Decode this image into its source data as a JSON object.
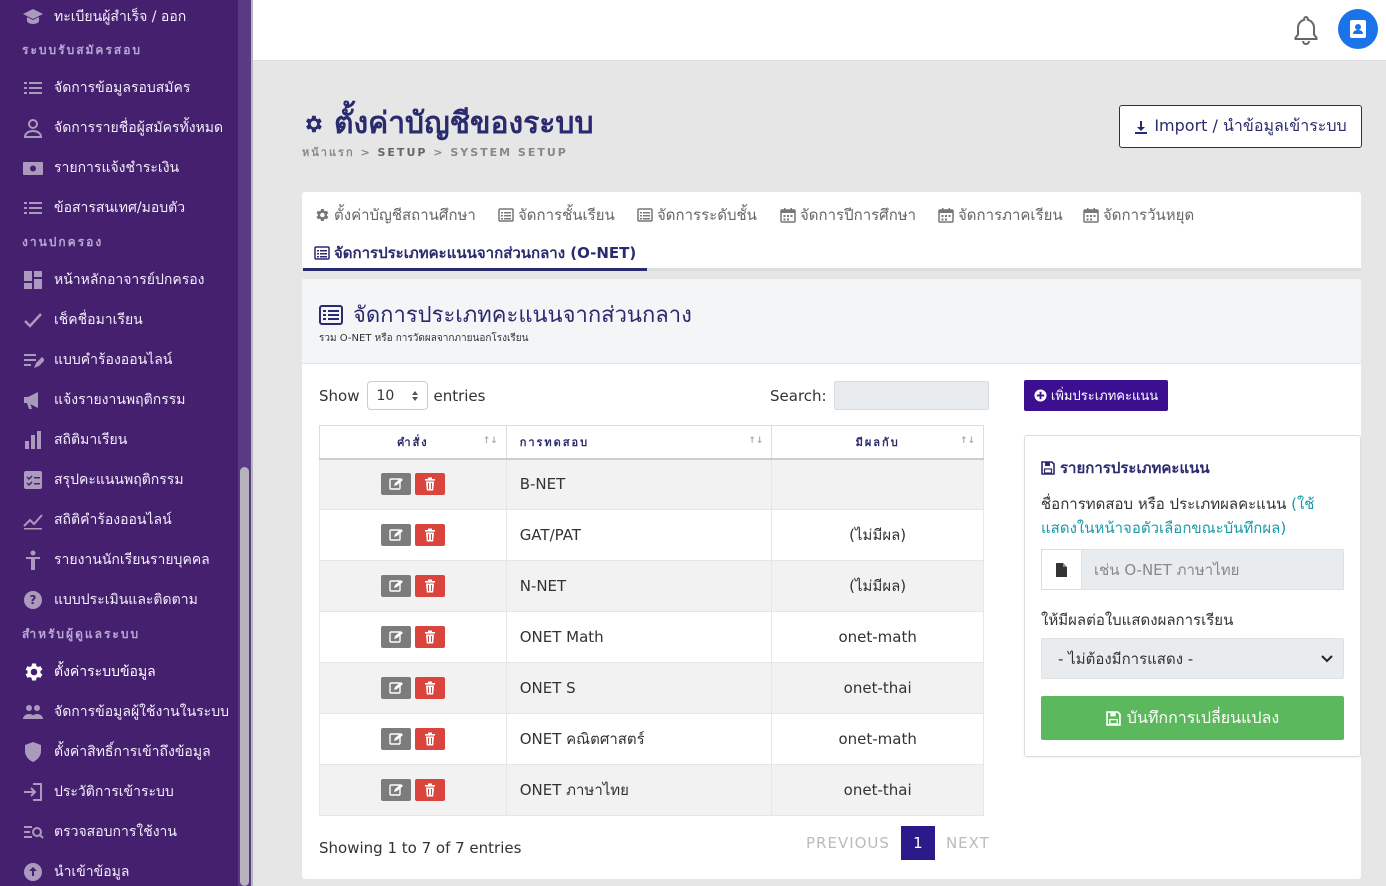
{
  "sidebar": {
    "items_top": [
      {
        "label": "ทะเบียนผู้สำเร็จ / ออก",
        "icon": "graduation-cap-icon"
      }
    ],
    "section1": "ระบบรับสมัครสอบ",
    "items1": [
      {
        "label": "จัดการข้อมูลรอบสมัคร",
        "icon": "list-icon"
      },
      {
        "label": "จัดการรายชื่อผู้สมัครทั้งหมด",
        "icon": "user-icon"
      },
      {
        "label": "รายการแจ้งชำระเงิน",
        "icon": "money-icon"
      },
      {
        "label": "ข้อสารสนเทศ/มอบตัว",
        "icon": "list-icon"
      }
    ],
    "section2": "งานปกครอง",
    "items2": [
      {
        "label": "หน้าหลักอาจารย์ปกครอง",
        "icon": "dashboard-icon"
      },
      {
        "label": "เช็คชื่อมาเรียน",
        "icon": "check-icon"
      },
      {
        "label": "แบบคำร้องออนไลน์",
        "icon": "list-edit-icon"
      },
      {
        "label": "แจ้งรายงานพฤติกรรม",
        "icon": "megaphone-icon"
      },
      {
        "label": "สถิติมาเรียน",
        "icon": "bar-chart-icon"
      },
      {
        "label": "สรุปคะแนนพฤติกรรม",
        "icon": "checklist-icon"
      },
      {
        "label": "สถิติคำร้องออนไลน์",
        "icon": "line-chart-icon"
      },
      {
        "label": "รายงานนักเรียนรายบุคคล",
        "icon": "person-icon"
      },
      {
        "label": "แบบประเมินและติดตาม",
        "icon": "help-icon"
      }
    ],
    "section3": "สำหรับผู้ดูแลระบบ",
    "items3": [
      {
        "label": "ตั้งค่าระบบข้อมูล",
        "icon": "gear-icon",
        "active": true
      },
      {
        "label": "จัดการข้อมูลผู้ใช้งานในระบบ",
        "icon": "users-icon"
      },
      {
        "label": "ตั้งค่าสิทธิ์การเข้าถึงข้อมูล",
        "icon": "shield-icon"
      },
      {
        "label": "ประวัติการเข้าระบบ",
        "icon": "login-icon"
      },
      {
        "label": "ตรวจสอบการใช้งาน",
        "icon": "search-list-icon"
      },
      {
        "label": "นำเข้าข้อมูล",
        "icon": "upload-icon"
      }
    ]
  },
  "header": {
    "title": "ตั้งค่าบัญชีของระบบ",
    "breadcrumb": [
      "หน้าแรก",
      "SETUP",
      "SYSTEM SETUP"
    ],
    "import_label": "Import / นำข้อมูลเข้าระบบ"
  },
  "tabs": [
    {
      "label": "ตั้งค่าบัญชีสถานศึกษา",
      "icon": "gear-icon"
    },
    {
      "label": "จัดการชั้นเรียน",
      "icon": "list-alt-icon"
    },
    {
      "label": "จัดการระดับชั้น",
      "icon": "list-alt-icon"
    },
    {
      "label": "จัดการปีการศึกษา",
      "icon": "calendar-icon"
    },
    {
      "label": "จัดการภาคเรียน",
      "icon": "calendar-icon"
    },
    {
      "label": "จัดการวันหยุด",
      "icon": "calendar-icon"
    },
    {
      "label": "จัดการประเภทคะแนนจากส่วนกลาง (O-NET)",
      "icon": "list-alt-icon",
      "active": true
    }
  ],
  "card": {
    "title": "จัดการประเภทคะแนนจากส่วนกลาง",
    "subtitle": "รวม O-NET หรือ การวัดผลจากภายนอกโรงเรียน"
  },
  "table": {
    "show_label": "Show",
    "entries_value": "10",
    "entries_label": "entries",
    "search_label": "Search:",
    "columns": [
      "คำสั่ง",
      "การทดสอบ",
      "มีผลกับ"
    ],
    "rows": [
      {
        "name": "B-NET",
        "result": ""
      },
      {
        "name": "GAT/PAT",
        "result": "(ไม่มีผล)"
      },
      {
        "name": "N-NET",
        "result": "(ไม่มีผล)"
      },
      {
        "name": "ONET Math",
        "result": "onet-math"
      },
      {
        "name": "ONET S",
        "result": "onet-thai"
      },
      {
        "name": "ONET คณิตศาสตร์",
        "result": "onet-math"
      },
      {
        "name": "ONET ภาษาไทย",
        "result": "onet-thai"
      }
    ],
    "info": "Showing 1 to 7 of 7 entries",
    "prev": "PREVIOUS",
    "page": "1",
    "next": "NEXT"
  },
  "form": {
    "add_label": "เพิ่มประเภทคะแนน",
    "title": "รายการประเภทคะแนน",
    "label1": "ชื่อการทดสอบ หรือ ประเภทผลคะแนน",
    "hint1": "(ใช้แสดงในหน้าจอตัวเลือกขณะบันทึกผล)",
    "input_placeholder": "เช่น O-NET ภาษาไทย",
    "label2": "ให้มีผลต่อใบแสดงผลการเรียน",
    "select_value": "- ไม่ต้องมีการแสดง -",
    "save_label": "บันทึกการเปลี่ยนแปลง"
  },
  "colors": {
    "sidebar_bg": "#45206f",
    "primary": "#2a2a6e",
    "add_btn": "#3b0f8f",
    "success": "#5cb85c",
    "danger": "#d9443d",
    "avatar": "#1a73e8"
  }
}
